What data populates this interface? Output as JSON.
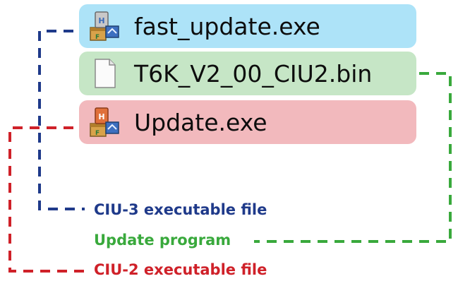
{
  "files": [
    {
      "name": "fast_update.exe",
      "icon": "installer-exe-icon"
    },
    {
      "name": "T6K_V2_00_CIU2.bin",
      "icon": "blank-file-icon"
    },
    {
      "name": "Update.exe",
      "icon": "installer-exe-icon"
    }
  ],
  "labels": {
    "ciu3": "CIU-3 executable file",
    "update_program": "Update program",
    "ciu2": "CIU-2 executable file"
  },
  "colors": {
    "blue_row": "#ade3f8",
    "green_row": "#c6e6c6",
    "red_row": "#f2b9bd",
    "blue_line": "#1f3a8a",
    "green_line": "#39a93c",
    "red_line": "#cf2129"
  }
}
